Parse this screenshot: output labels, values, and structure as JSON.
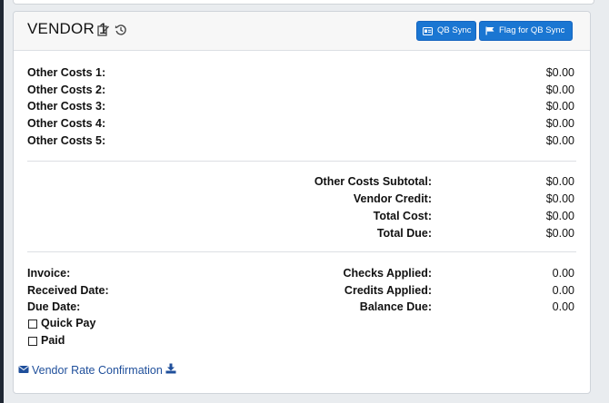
{
  "header": {
    "title": "VENDOR 1",
    "qb_sync_label": "QB Sync",
    "flag_label": "Flag for QB Sync"
  },
  "other_costs": [
    {
      "label": "Other Costs 1:",
      "value": "$0.00"
    },
    {
      "label": "Other Costs 2:",
      "value": "$0.00"
    },
    {
      "label": "Other Costs 3:",
      "value": "$0.00"
    },
    {
      "label": "Other Costs 4:",
      "value": "$0.00"
    },
    {
      "label": "Other Costs 5:",
      "value": "$0.00"
    }
  ],
  "totals": [
    {
      "label": "Other Costs Subtotal:",
      "value": "$0.00"
    },
    {
      "label": "Vendor Credit:",
      "value": "$0.00"
    },
    {
      "label": "Total Cost:",
      "value": "$0.00"
    },
    {
      "label": "Total Due:",
      "value": "$0.00"
    }
  ],
  "invoice": {
    "invoice_label": "Invoice:",
    "received_label": "Received Date:",
    "due_label": "Due Date:",
    "quick_pay_label": "Quick Pay",
    "paid_label": "Paid",
    "quick_pay_checked": false,
    "paid_checked": false
  },
  "payments": [
    {
      "label": "Checks Applied:",
      "value": "0.00"
    },
    {
      "label": "Credits Applied:",
      "value": "0.00"
    },
    {
      "label": "Balance Due:",
      "value": "0.00"
    }
  ],
  "link": {
    "label": "Vendor Rate Confirmation"
  },
  "colors": {
    "button": "#1a76d2",
    "link": "#1f4f9b"
  },
  "icons": {
    "edit": "edit-icon",
    "history": "history-icon",
    "qb": "id-card-icon",
    "flag": "flag-icon",
    "envelope": "envelope-icon",
    "download": "download-icon"
  }
}
